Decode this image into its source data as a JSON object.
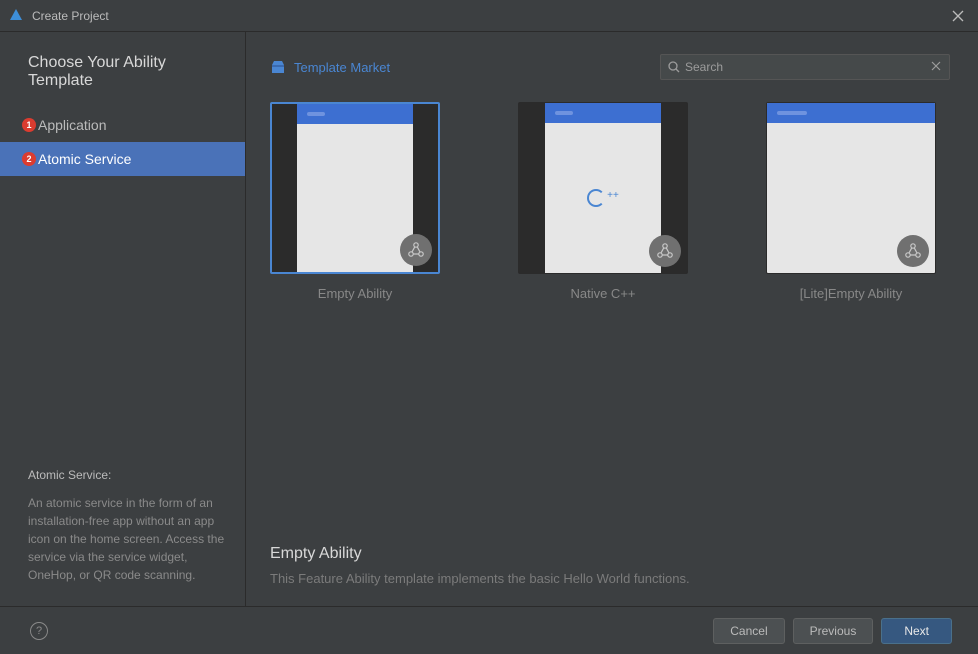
{
  "window": {
    "title": "Create Project"
  },
  "heading": "Choose Your Ability Template",
  "sidebar": {
    "items": [
      {
        "label": "Application",
        "badge": "1"
      },
      {
        "label": "Atomic Service",
        "badge": "2"
      }
    ],
    "help": {
      "title": "Atomic Service:",
      "body": "An atomic service in the form of an installation-free app without an app icon on the home screen. Access the service via the service widget, OneHop, or QR code scanning."
    }
  },
  "main": {
    "template_market_label": "Template Market",
    "search_placeholder": "Search",
    "templates": [
      {
        "label": "Empty Ability",
        "preview_kind": "blank",
        "selected": true
      },
      {
        "label": "Native C++",
        "preview_kind": "cpp",
        "selected": false
      },
      {
        "label": "[Lite]Empty Ability",
        "preview_kind": "blank-wide",
        "selected": false
      }
    ],
    "selected_detail": {
      "title": "Empty Ability",
      "description": "This Feature Ability template implements the basic Hello World functions."
    }
  },
  "footer": {
    "cancel": "Cancel",
    "previous": "Previous",
    "next": "Next"
  }
}
